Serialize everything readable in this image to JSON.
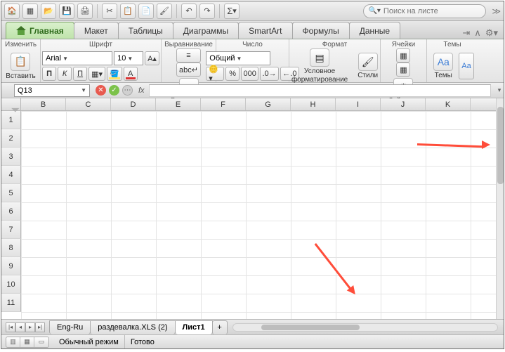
{
  "toolbar_icons": [
    "🏠",
    "▦",
    "📂",
    "💾",
    "🖨",
    "✂",
    "📋",
    "📋",
    "🧹",
    "↶",
    "↷"
  ],
  "sigma": "Σ",
  "search": {
    "placeholder": "Поиск на листе"
  },
  "tabs": {
    "home": "Главная",
    "layout": "Макет",
    "tables": "Таблицы",
    "charts": "Диаграммы",
    "smartart": "SmartArt",
    "formulas": "Формулы",
    "data": "Данные"
  },
  "groups": {
    "edit_title": "Изменить",
    "paste": "Вставить",
    "font_title": "Шрифт",
    "font_name": "Arial",
    "font_size": "10",
    "bold": "П",
    "italic": "К",
    "underline": "П",
    "align_title": "Выравнивание",
    "align_label": "Выровнять",
    "number_title": "Число",
    "number_format": "Общий",
    "format_title": "Формат",
    "cond_fmt": "Условное",
    "cond_fmt2": "форматирование",
    "styles": "Стили",
    "cells_title": "Ячейки",
    "actions": "Действия",
    "themes_title": "Темы",
    "themes": "Темы"
  },
  "reference": {
    "cell": "Q13",
    "fx": "fx"
  },
  "columns": [
    "B",
    "C",
    "D",
    "E",
    "F",
    "G",
    "H",
    "I",
    "J",
    "K"
  ],
  "rows": [
    "1",
    "2",
    "3",
    "4",
    "5",
    "6",
    "7",
    "8",
    "9",
    "10",
    "11"
  ],
  "sheets": {
    "s1": "Eng-Ru",
    "s2": "раздевалка.XLS (2)",
    "s3": "Лист1",
    "add": "+"
  },
  "status": {
    "mode": "Обычный режим",
    "ready": "Готово"
  }
}
